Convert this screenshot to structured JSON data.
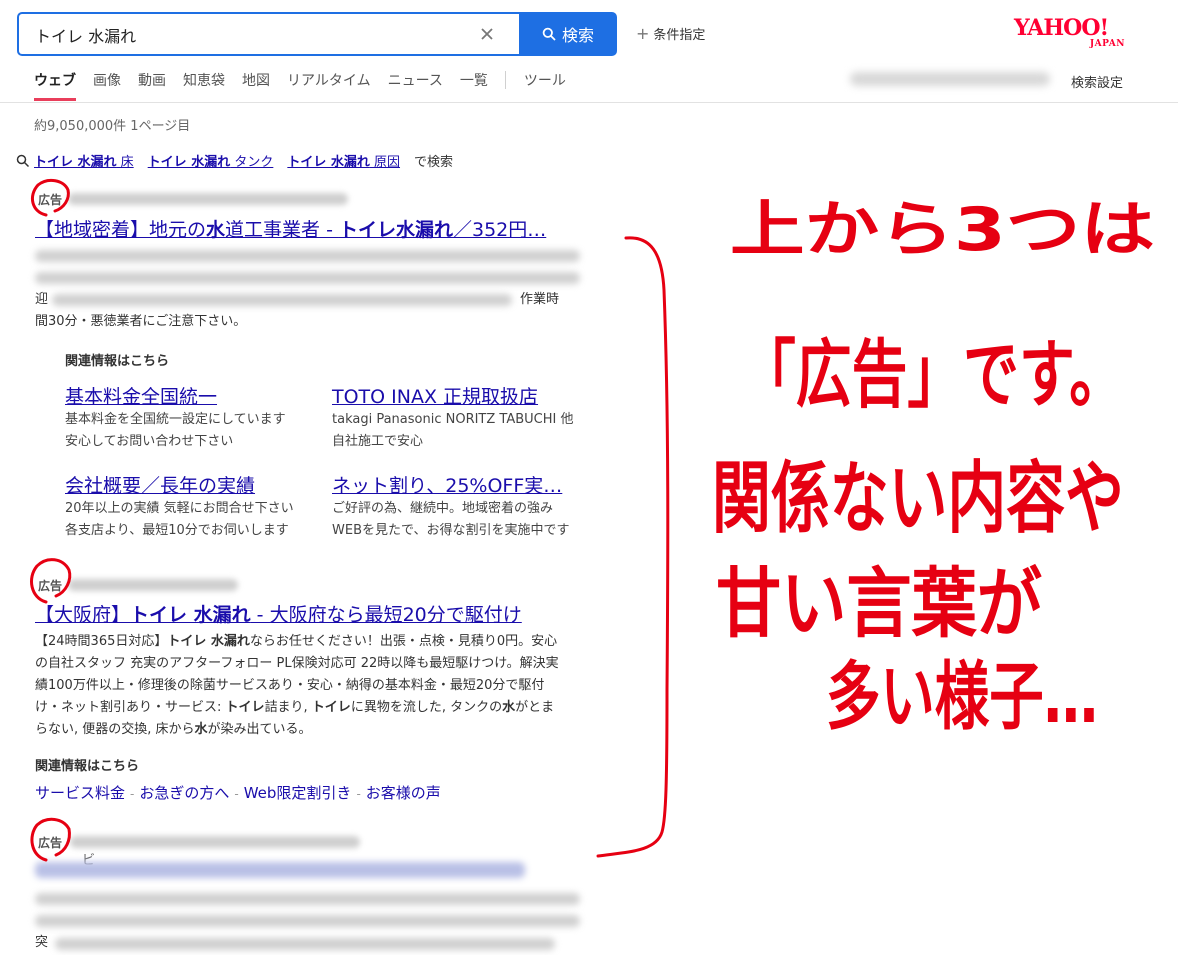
{
  "search": {
    "query": "トイレ 水漏れ",
    "button_label": "検索",
    "conditions_label": "条件指定"
  },
  "logo": {
    "text": "YAHOO!",
    "sub": "JAPAN"
  },
  "tabs": [
    {
      "label": "ウェブ"
    },
    {
      "label": "画像"
    },
    {
      "label": "動画"
    },
    {
      "label": "知恵袋"
    },
    {
      "label": "地図"
    },
    {
      "label": "リアルタイム"
    },
    {
      "label": "ニュース"
    },
    {
      "label": "一覧"
    }
  ],
  "tools_label": "ツール",
  "settings_label": "検索設定",
  "result_count": "約9,050,000件  1ページ目",
  "related": {
    "items": [
      {
        "bold": "トイレ 水漏れ",
        "rest": " 床"
      },
      {
        "bold": "トイレ 水漏れ",
        "rest": " タンク"
      },
      {
        "bold": "トイレ 水漏れ",
        "rest": " 原因"
      }
    ],
    "suffix": "で検索"
  },
  "ads": [
    {
      "label": "広告",
      "title_parts": [
        "【地域密着】地元の",
        "水",
        "道工事業者 - ",
        "トイレ水漏れ",
        "／352円…"
      ],
      "desc_line3_start": "迎",
      "desc_line3_end": "作業時",
      "desc_line4": "間30分・悪徳業者にご注意下さい。",
      "sub_heading": "関連情報はこちら",
      "sublinks": [
        {
          "title": "基本料金全国統一",
          "desc1": "基本料金を全国統一設定にしています",
          "desc2": "安心してお問い合わせ下さい"
        },
        {
          "title": "TOTO INAX 正規取扱店",
          "desc1": "takagi Panasonic NORITZ TABUCHI 他",
          "desc2": "自社施工で安心"
        },
        {
          "title": "会社概要／長年の実績",
          "desc1": "20年以上の実績 気軽にお問合せ下さい",
          "desc2": "各支店より、最短10分でお伺いします"
        },
        {
          "title": "ネット割り、25%OFF実…",
          "desc1": "ご好評の為、継続中。地域密着の強み",
          "desc2": "WEBを見たで、お得な割引を実施中です"
        }
      ]
    },
    {
      "label": "広告",
      "title_parts": [
        "【大阪府】",
        "トイレ 水漏れ",
        " - 大阪府なら最短20分で駆付け"
      ],
      "desc_lines": [
        [
          "【24時間365日対応】",
          "トイレ 水漏れ",
          "ならお任せください！出張・点検・見積り0円。安心"
        ],
        [
          "の自社スタッフ 充実のアフターフォロー PL保険対応可 22時以降も最短駆けつけ。解決実"
        ],
        [
          "績100万件以上・修理後の除菌サービスあり・安心・納得の基本料金・最短20分で駆付"
        ],
        [
          "け・ネット割引あり・サービス: ",
          "トイレ",
          "詰まり, ",
          "トイレ",
          "に異物を流した, タンクの",
          "水",
          "がとま"
        ],
        [
          "らない, 便器の交換, 床から",
          "水",
          "が染み出ている。"
        ]
      ],
      "sub_heading": "関連情報はこちら",
      "inline_links": [
        "サービス料金",
        "お急ぎの方へ",
        "Web限定割引き",
        "お客様の声"
      ]
    },
    {
      "label": "広告",
      "partial_text": "ビ",
      "last_line_start": "突"
    }
  ],
  "annotation": {
    "lines": [
      "上から3つは",
      "「広告」です。",
      "関係ない内容や",
      "甘い言葉が",
      "多い様子…"
    ],
    "color": "#e60012"
  }
}
